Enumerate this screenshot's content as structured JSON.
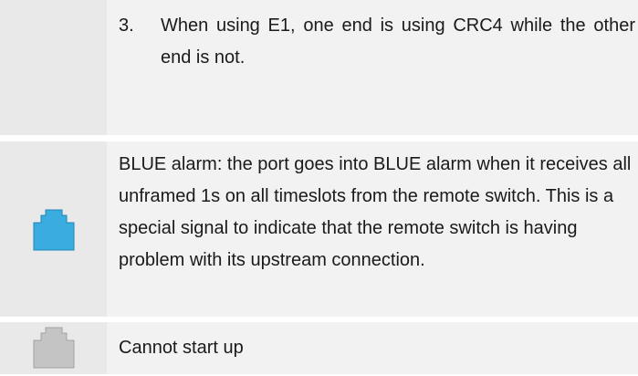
{
  "rows": [
    {
      "list_number": "3.",
      "text": "When using E1, one end is using CRC4 while the other end is not."
    },
    {
      "icon": {
        "name": "port-blue-icon",
        "color": "#3aace0",
        "outline": "#1c86b8"
      },
      "text": "BLUE alarm: the port goes into BLUE alarm when it receives all unframed 1s on all timeslots from the remote switch. This is a special signal to indicate that the remote switch is having problem with its upstream connection."
    },
    {
      "icon": {
        "name": "port-gray-icon",
        "color": "#c4c4c4",
        "outline": "#a2a2a2"
      },
      "text": "Cannot start up"
    }
  ]
}
